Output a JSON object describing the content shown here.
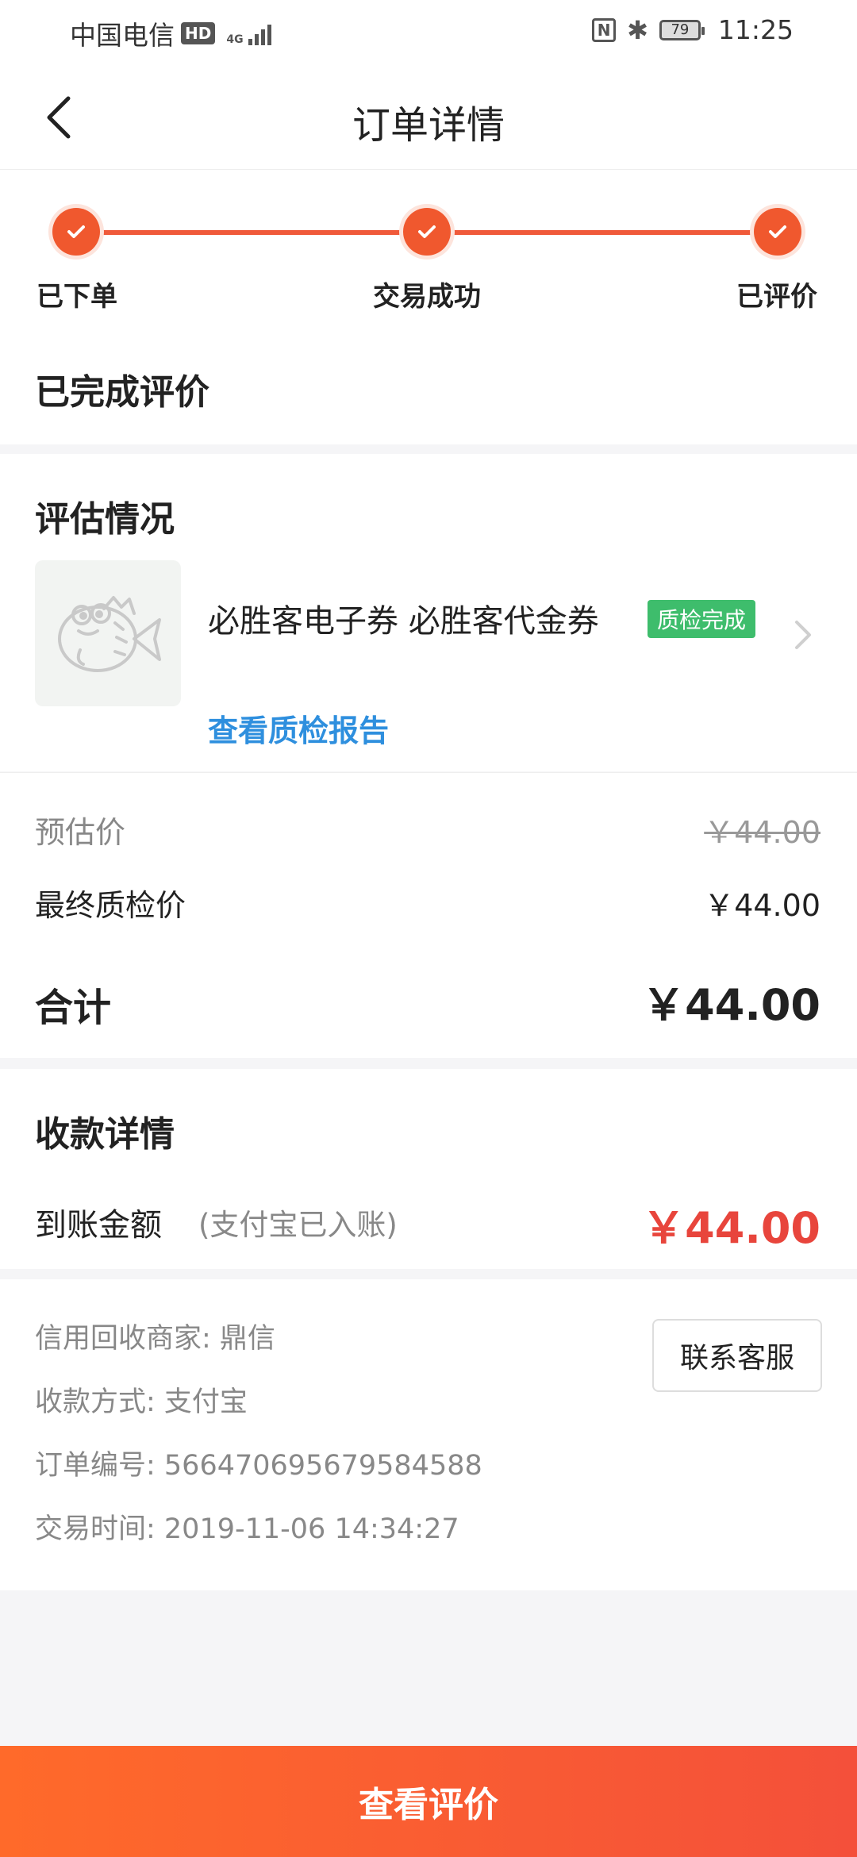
{
  "status_bar": {
    "carrier": "中国电信",
    "hd_badge": "HD",
    "network": "4G",
    "nfc": "N",
    "battery": "79",
    "time": "11:25"
  },
  "nav": {
    "title": "订单详情"
  },
  "progress": {
    "steps": [
      {
        "label": "已下单"
      },
      {
        "label": "交易成功"
      },
      {
        "label": "已评价"
      }
    ],
    "status_title": "已完成评价"
  },
  "evaluation": {
    "title": "评估情况",
    "product_name": "必胜客电子券 必胜客代金券",
    "qc_badge": "质检完成",
    "qc_link": "查看质检报告"
  },
  "price": {
    "estimated_label": "预估价",
    "estimated_value": "￥44.00",
    "final_label": "最终质检价",
    "final_value": "￥44.00",
    "total_label": "合计",
    "total_value": "￥44.00"
  },
  "payment": {
    "title": "收款详情",
    "received_label": "到账金额",
    "received_note": "(支付宝已入账)",
    "received_value": "￥44.00"
  },
  "info": {
    "merchant": "信用回收商家: 鼎信",
    "method": "收款方式: 支付宝",
    "order_no": "订单编号: 566470695679584588",
    "time": "交易时间: 2019-11-06 14:34:27",
    "contact_label": "联系客服"
  },
  "bottom": {
    "button_label": "查看评价"
  },
  "colors": {
    "accent": "#f0582e",
    "link": "#2e8fde",
    "success": "#3ebd6c",
    "amount_red": "#e8453c"
  }
}
